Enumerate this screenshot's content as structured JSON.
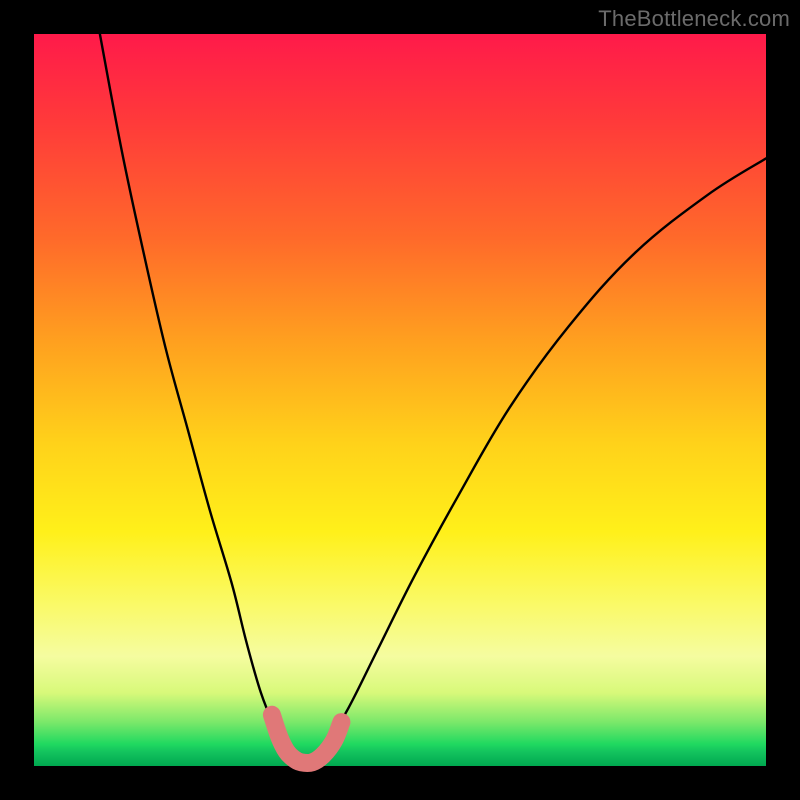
{
  "watermark": "TheBottleneck.com",
  "chart_data": {
    "type": "line",
    "title": "",
    "xlabel": "",
    "ylabel": "",
    "xlim": [
      0,
      100
    ],
    "ylim": [
      0,
      100
    ],
    "series": [
      {
        "name": "bottleneck-curve",
        "x": [
          9,
          12,
          15,
          18,
          21,
          24,
          27,
          29,
          31,
          33,
          34.5,
          36,
          38,
          40,
          43,
          47,
          52,
          58,
          65,
          73,
          82,
          92,
          100
        ],
        "values": [
          100,
          84,
          70,
          57,
          46,
          35,
          25,
          17,
          10,
          5,
          2,
          0,
          0,
          3,
          8,
          16,
          26,
          37,
          49,
          60,
          70,
          78,
          83
        ]
      },
      {
        "name": "highlight-segment",
        "x": [
          32.5,
          33.5,
          34.5,
          35.5,
          36.5,
          38,
          39.5,
          41,
          42
        ],
        "values": [
          7,
          4,
          2,
          1,
          0.5,
          0.5,
          1.5,
          3.5,
          6
        ]
      }
    ],
    "colors": {
      "curve": "#000000",
      "highlight": "#e07878"
    }
  }
}
